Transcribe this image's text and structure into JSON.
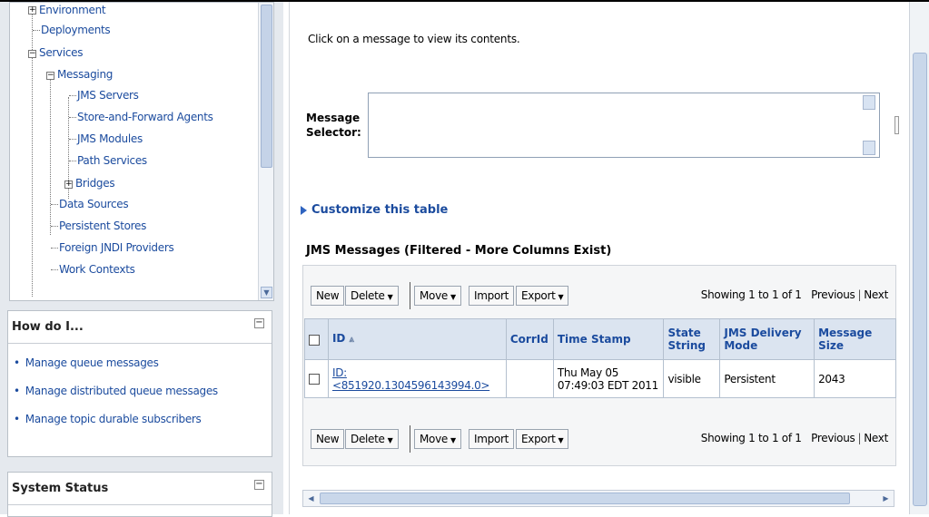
{
  "tree": {
    "items": [
      {
        "label": "Environment",
        "toggle": "+"
      },
      {
        "label": "Deployments"
      },
      {
        "label": "Services",
        "toggle": "−"
      },
      {
        "label": "Messaging",
        "toggle": "−"
      },
      {
        "label": "JMS Servers"
      },
      {
        "label": "Store-and-Forward Agents"
      },
      {
        "label": "JMS Modules"
      },
      {
        "label": "Path Services"
      },
      {
        "label": "Bridges",
        "toggle": "+"
      },
      {
        "label": "Data Sources"
      },
      {
        "label": "Persistent Stores"
      },
      {
        "label": "Foreign JNDI Providers"
      },
      {
        "label": "Work Contexts"
      }
    ]
  },
  "how_do_i": {
    "title": "How do I...",
    "items": [
      "Manage queue messages",
      "Manage distributed queue messages",
      "Manage topic durable subscribers"
    ]
  },
  "system_status": {
    "title": "System Status"
  },
  "main": {
    "intro": "Click on a message to view its contents.",
    "selector_label_1": "Message",
    "selector_label_2": "Selector:",
    "selector_value": "",
    "customize": "Customize this table",
    "table_title": "JMS Messages (Filtered - More Columns Exist)",
    "toolbar": {
      "new": "New",
      "delete": "Delete",
      "move": "Move",
      "import": "Import",
      "export": "Export",
      "showing": "Showing 1 to 1 of 1",
      "previous": "Previous",
      "next": "Next"
    },
    "columns": [
      "ID",
      "CorrId",
      "Time Stamp",
      "State String",
      "JMS Delivery Mode",
      "Message Size"
    ],
    "rows": [
      {
        "id": "ID:<851920.1304596143994.0>",
        "corrid": "",
        "timestamp_1": "Thu May 05",
        "timestamp_2": "07:49:03 EDT 2011",
        "state": "visible",
        "delivery": "Persistent",
        "size": "2043"
      }
    ]
  }
}
